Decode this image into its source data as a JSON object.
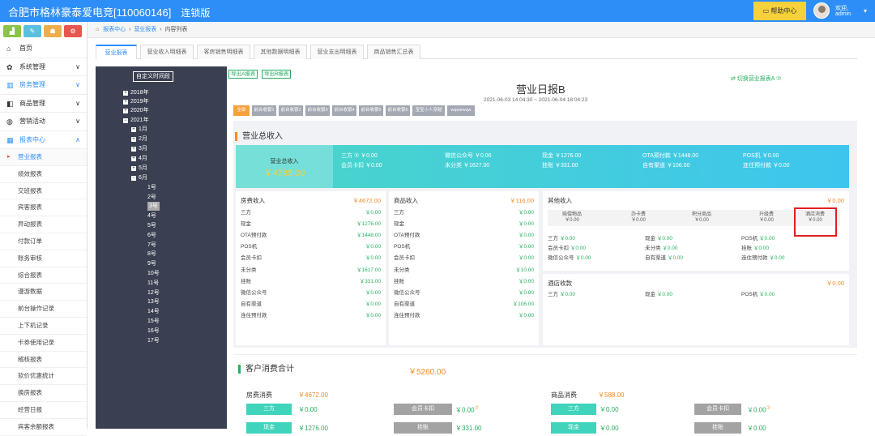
{
  "header": {
    "title": "合肥市格林豪泰爱电竞[110060146]",
    "chain": "连锁版",
    "help": "帮助中心",
    "greet": "欢迎,",
    "user": "admin"
  },
  "sidebar": {
    "items": [
      {
        "label": "首页",
        "icon": "⌂"
      },
      {
        "label": "系统管理",
        "icon": "✿",
        "arrow": "∨"
      },
      {
        "label": "房务管理",
        "icon": "▥",
        "arrow": "∨"
      },
      {
        "label": "商品管理",
        "icon": "◧",
        "arrow": "∨"
      },
      {
        "label": "营销活动",
        "icon": "◍",
        "arrow": "∨"
      },
      {
        "label": "报表中心",
        "icon": "▦",
        "arrow": "∧"
      }
    ],
    "subitems": [
      "营业报表",
      "绩效报表",
      "交班报表",
      "宾客报表",
      "异动报表",
      "付款订单",
      "账务审核",
      "综合报表",
      "漫游数据",
      "前台操作记录",
      "上下机记录",
      "卡券使用记录",
      "稽核报表",
      "软价优惠统计",
      "换房报表",
      "经营日报",
      "宾客余额报表"
    ]
  },
  "breadcrumb": {
    "home": "报表中心",
    "sec": "营业报表",
    "cur": "内容列表"
  },
  "tabs": [
    "营业报表",
    "营业收入明细表",
    "客房销售明细表",
    "其他数据明细表",
    "营业支出明细表",
    "商品销售汇总表"
  ],
  "tree": {
    "custom": "自定义时间段",
    "years": [
      "2018年",
      "2019年",
      "2020年",
      "2021年"
    ],
    "months": [
      "1月",
      "2月",
      "3月",
      "4月",
      "5月",
      "6月"
    ],
    "days": [
      "1号",
      "2号",
      "3号",
      "4号",
      "5号",
      "6号",
      "7号",
      "8号",
      "9号",
      "10号",
      "11号",
      "12号",
      "13号",
      "14号",
      "15号",
      "16号",
      "17号"
    ]
  },
  "report": {
    "export_a": "导出A报表",
    "export_b": "导出B报表",
    "switch": "⇄ 切换营业报表A ⑦",
    "title": "营业日报B",
    "range": "2021-06-03 14:04:30 ~ 2021-06-04 18:04:23",
    "chips": [
      "全部",
      "前台收银1",
      "前台收银2",
      "前台收银3",
      "前台收银4",
      "前台收银5",
      "前台收银6",
      "宝宝小人穿越",
      "wqwewqw"
    ]
  },
  "revenue": {
    "title": "营业总收入",
    "total_label": "营业总收入",
    "total": "￥4788.00",
    "banner": [
      [
        "三方 ⑦ ￥0.00",
        "微信公众号 ￥0.00",
        "现金 ￥1276.00",
        "OTA预付款 ￥1448.00",
        "POS机 ￥0.00"
      ],
      [
        "会员卡扣 ￥0.00",
        "未分类 ￥1627.00",
        "挂账 ￥331.00",
        "自有渠道 ￥106.00",
        "连住预付款 ￥0.00"
      ]
    ],
    "room": {
      "title": "房费收入",
      "value": "￥4672.00",
      "rows": [
        [
          "三方",
          "￥0.00"
        ],
        [
          "现金",
          "￥1276.00"
        ],
        [
          "OTA预付款",
          "￥1448.00"
        ],
        [
          "POS机",
          "￥0.00"
        ],
        [
          "会员卡扣",
          "￥0.00"
        ],
        [
          "未分类",
          "￥1617.00"
        ],
        [
          "挂账",
          "￥331.00"
        ],
        [
          "微信公众号",
          "￥0.00"
        ],
        [
          "自有渠道",
          "￥0.00"
        ],
        [
          "连住预付款",
          "￥0.00"
        ]
      ]
    },
    "goods": {
      "title": "商品收入",
      "value": "￥116.00",
      "rows": [
        [
          "三方",
          "￥0.00"
        ],
        [
          "现金",
          "￥0.00"
        ],
        [
          "OTA预付款",
          "￥0.00"
        ],
        [
          "POS机",
          "￥0.00"
        ],
        [
          "会员卡扣",
          "￥0.00"
        ],
        [
          "未分类",
          "￥10.00"
        ],
        [
          "挂账",
          "￥0.00"
        ],
        [
          "微信公众号",
          "￥0.00"
        ],
        [
          "自有渠道",
          "￥106.00"
        ],
        [
          "连住预付款",
          "￥0.00"
        ]
      ]
    },
    "other": {
      "title": "其他收入",
      "value": "￥0.00",
      "cats": [
        [
          "赔偿物品",
          "￥0.00"
        ],
        [
          "办卡费",
          "￥0.00"
        ],
        [
          "积分商品",
          "￥0.00"
        ],
        [
          "升级费",
          "￥0.00"
        ],
        [
          "酒店消费",
          "￥0.00"
        ]
      ],
      "pays": [
        [
          "三方",
          "￥0.00",
          "现金",
          "￥0.00",
          "POS机",
          "￥0.00"
        ],
        [
          "会员卡扣",
          "￥0.00",
          "未分类",
          "￥0.00",
          "挂账",
          "￥0.00"
        ],
        [
          "微信公众号",
          "￥0.00",
          "自有渠道",
          "￥0.00",
          "连住预付款",
          "￥0.00"
        ]
      ],
      "deposit_title": "酒店收款",
      "deposit_value": "￥0.00",
      "deposit_row": [
        "三方",
        "￥0.00",
        "现金",
        "￥0.00",
        "POS机",
        "￥0.00"
      ]
    }
  },
  "consume": {
    "title": "客户消费合计",
    "total": "￥5260.00",
    "room_label": "房费消费",
    "room_value": "￥4672.00",
    "goods_label": "商品消费",
    "goods_value": "￥588.00",
    "p1": "三方",
    "p1v": "￥0.00",
    "p2": "会员卡扣",
    "p2v": "￥0.00",
    "p2s": "⑦",
    "p3": "现金",
    "p3v": "￥1276.00",
    "p4": "挂账",
    "p4v": "￥331.00",
    "g1": "三方",
    "g1v": "￥0.00",
    "g2": "会员卡扣",
    "g2v": "￥0.00",
    "g2s": "⑦",
    "g3": "现金",
    "g3v": "￥0.00",
    "g4": "挂账",
    "g4v": "￥0.00"
  },
  "colors": {
    "blue": "#2e8ef7",
    "green": "#27ae60",
    "orange": "#f48b2a",
    "teal": "#3ec5ee",
    "sidebarBtn": [
      "#8bc34a",
      "#5bc0de",
      "#f0ad4e",
      "#e8574f"
    ]
  }
}
